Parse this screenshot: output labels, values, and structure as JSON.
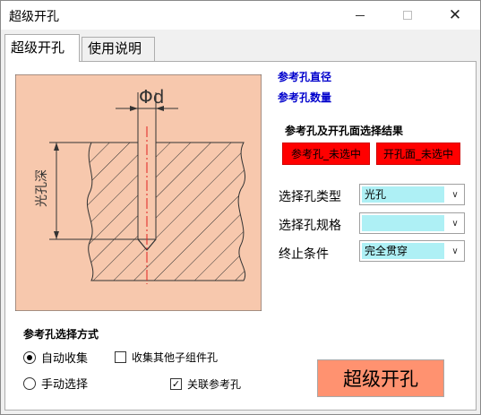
{
  "window": {
    "title": "超级开孔",
    "controls": {
      "minimize": "─",
      "maximize": "☐",
      "close": "✕"
    }
  },
  "tabs": [
    {
      "label": "超级开孔",
      "active": true
    },
    {
      "label": "使用说明",
      "active": false
    }
  ],
  "diagram": {
    "dimension_label": "Φd",
    "depth_label": "光孔深"
  },
  "reference": {
    "hole_diameter_label": "参考孔直径",
    "hole_count_label": "参考孔数量",
    "selection_result_label": "参考孔及开孔面选择结果",
    "ref_hole_status": "参考孔_未选中",
    "face_status": "开孔面_未选中"
  },
  "form": {
    "hole_type": {
      "label": "选择孔类型",
      "value": "光孔"
    },
    "hole_spec": {
      "label": "选择孔规格",
      "value": ""
    },
    "end_condition": {
      "label": "终止条件",
      "value": "完全贯穿"
    }
  },
  "selection_mode": {
    "group_label": "参考孔选择方式",
    "auto_label": "自动收集",
    "auto_checked": true,
    "manual_label": "手动选择",
    "manual_checked": false,
    "collect_sub_label": "收集其他子组件孔",
    "collect_sub_checked": false,
    "link_ref_label": "关联参考孔",
    "link_ref_checked": true
  },
  "action": {
    "label": "超级开孔"
  },
  "colors": {
    "diagram_bg": "#f7c8ad",
    "status_red": "#ff0000",
    "action_button": "#ff9270",
    "combo_fill": "#aef0f5",
    "blue_text": "#0000cc"
  }
}
